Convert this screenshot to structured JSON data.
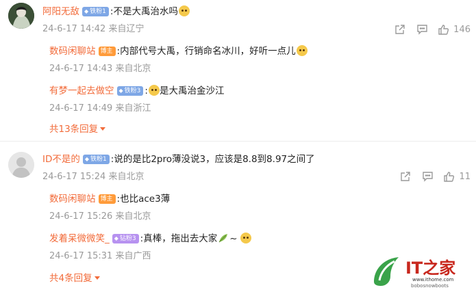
{
  "comments": [
    {
      "user": "阿阳无敌",
      "badge": "铁粉1",
      "text": ":不是大禹治水吗",
      "time": "24-6-17 14:42",
      "location": "来自辽宁",
      "likes": "146",
      "replies": [
        {
          "user": "数码闲聊站",
          "badge": "博主",
          "text": ":内部代号大禹，行销命名冰川，好听一点儿",
          "time": "24-6-17 14:43",
          "location": "来自北京"
        },
        {
          "user": "有梦一起去做空",
          "badge": "铁粉3",
          "text": "是大禹治金沙江",
          "time": "24-6-17 14:49",
          "location": "来自浙江"
        }
      ],
      "more": "共13条回复"
    },
    {
      "user": "ID不是的",
      "badge": "铁粉1",
      "text": ":说的是比2pro薄没说3，应该是8.8到8.97之间了",
      "time": "24-6-17 15:24",
      "location": "来自北京",
      "likes": "11",
      "replies": [
        {
          "user": "数码闲聊站",
          "badge": "博主",
          "text": ":也比ace3薄",
          "time": "24-6-17 15:26",
          "location": "来自北京"
        },
        {
          "user": "发着呆微微笑_",
          "badge": "钻粉3",
          "text": ":真棒，拖出去大家",
          "tail": "~",
          "time": "24-6-17 15:31",
          "location": "来自广西"
        }
      ],
      "more": "共4条回复"
    }
  ],
  "watermark": {
    "text": "IT之家",
    "url": "www.ithome.com",
    "credit": "bobosnowboots"
  },
  "colors": {
    "accent": "#f26b3a",
    "meta": "#9a9a9a",
    "fan_badge": "#7ea7e6",
    "author_badge": "#ff9b3a",
    "drill_badge": "#b792f0"
  }
}
